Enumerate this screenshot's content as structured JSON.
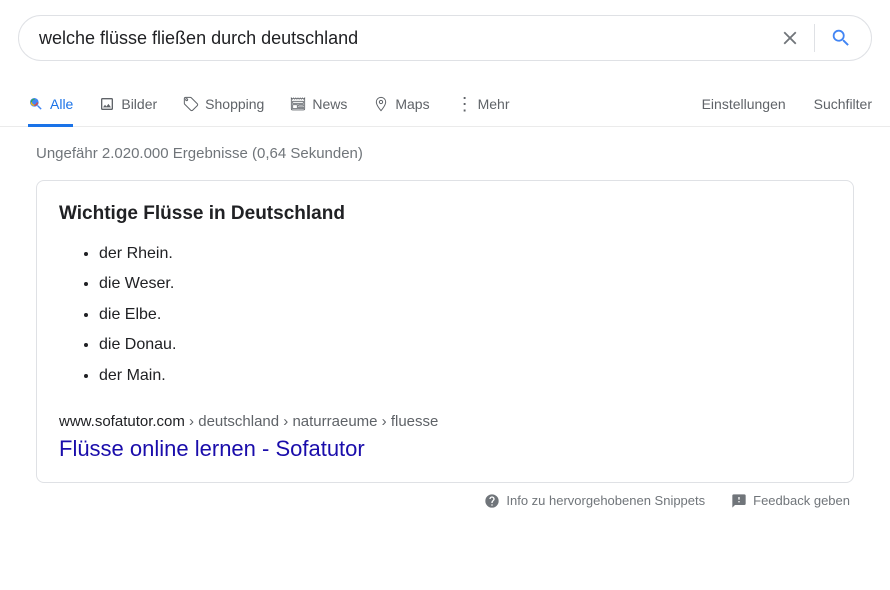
{
  "search": {
    "query": "welche flüsse fließen durch deutschland"
  },
  "tabs": {
    "all": "Alle",
    "images": "Bilder",
    "shopping": "Shopping",
    "news": "News",
    "maps": "Maps",
    "more": "Mehr",
    "settings": "Einstellungen",
    "tools": "Suchfilter"
  },
  "stats": "Ungefähr 2.020.000 Ergebnisse (0,64 Sekunden)",
  "featured": {
    "heading": "Wichtige Flüsse in Deutschland",
    "items": [
      "der Rhein.",
      "die Weser.",
      "die Elbe.",
      "die Donau.",
      "der Main."
    ],
    "site": "www.sofatutor.com",
    "path": " › deutschland › naturraeume › fluesse",
    "title": "Flüsse online lernen - Sofatutor"
  },
  "footer": {
    "info": "Info zu hervorgehobenen Snippets",
    "feedback": "Feedback geben"
  }
}
